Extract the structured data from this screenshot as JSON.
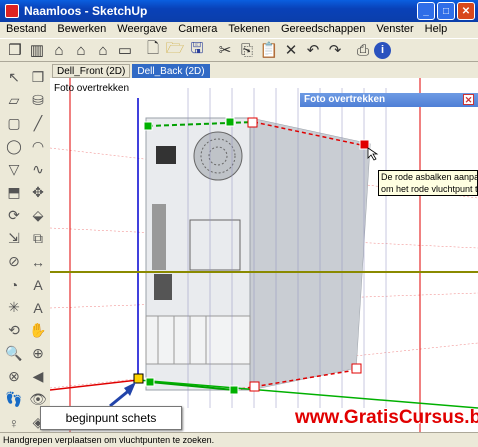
{
  "window": {
    "title": "Naamloos - SketchUp",
    "buttons": {
      "minimize": "_",
      "maximize": "□",
      "close": "✕"
    }
  },
  "menubar": {
    "items": [
      "Bestand",
      "Bewerken",
      "Weergave",
      "Camera",
      "Tekenen",
      "Gereedschappen",
      "Venster",
      "Help"
    ]
  },
  "toolbar": {
    "icons": [
      "components-icon",
      "open-door-icon",
      "house-icon",
      "house-front-icon",
      "house-side-icon",
      "house-top-icon",
      "new-file-icon",
      "open-folder-icon",
      "save-icon",
      "cut-icon",
      "copy-icon",
      "paste-icon",
      "delete-icon",
      "undo-icon",
      "redo-icon",
      "print-icon",
      "info-icon"
    ]
  },
  "palette": {
    "icons": [
      "select-icon",
      "make-component-icon",
      "eraser-icon",
      "paint-bucket-icon",
      "rectangle-icon",
      "line-icon",
      "circle-icon",
      "arc-icon",
      "polygon-icon",
      "freehand-icon",
      "push-pull-icon",
      "move-icon",
      "rotate-icon",
      "follow-me-icon",
      "scale-icon",
      "offset-icon",
      "tape-measure-icon",
      "dimension-icon",
      "protractor-icon",
      "text-icon",
      "axes-icon",
      "3d-text-icon",
      "orbit-icon",
      "pan-icon",
      "zoom-icon",
      "zoom-window-icon",
      "zoom-extents-icon",
      "previous-view-icon",
      "walk-icon",
      "look-around-icon",
      "position-camera-icon",
      "section-plane-icon"
    ]
  },
  "tabs": [
    {
      "label": "Dell_Front (2D)",
      "active": false
    },
    {
      "label": "Dell_Back (2D)",
      "active": true
    }
  ],
  "viewport": {
    "scene_label": "Foto overtrekken"
  },
  "dialog": {
    "title": "Foto overtrekken",
    "close": "✕"
  },
  "tooltip": {
    "line1": "De rode asbalken aanpassen",
    "line2": "om het rode vluchtpunt te zetten"
  },
  "callout": {
    "text": "beginpunt schets"
  },
  "watermark": {
    "text": "www.GratisCursus.be"
  },
  "statusbar": {
    "text": "Handgrepen verplaatsen om vluchtpunten te zoeken."
  },
  "colors": {
    "red_axis": "#e00000",
    "green_axis": "#00b000",
    "blue_axis": "#0000d0",
    "horizon": "#8a8a00",
    "title_blue": "#0a46c8"
  }
}
